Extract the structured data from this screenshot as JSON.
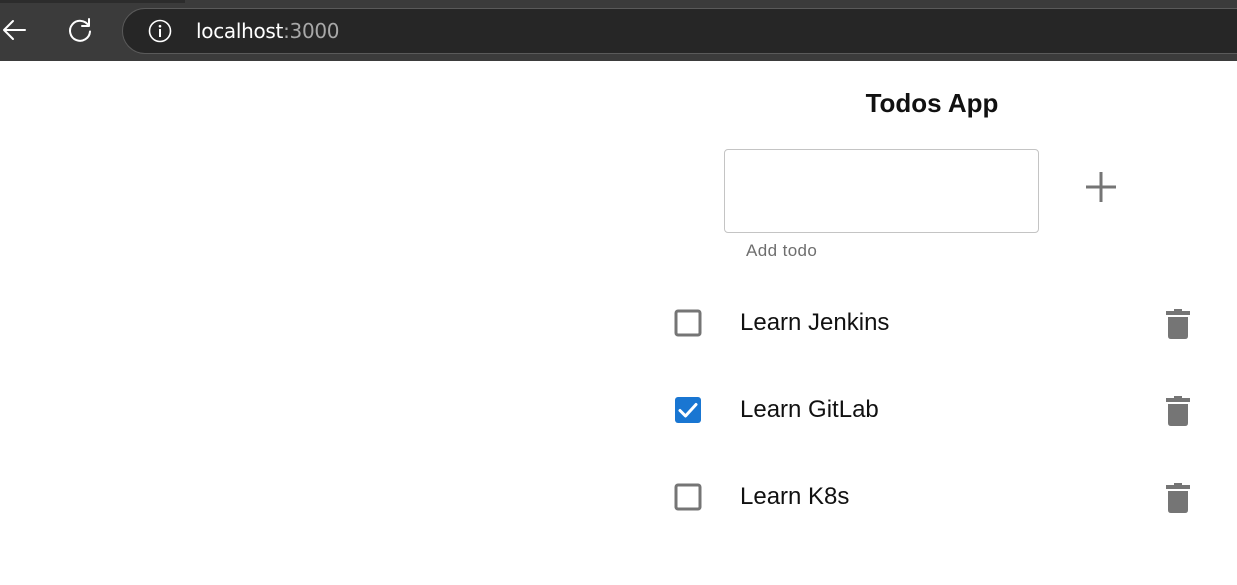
{
  "browser": {
    "url_host": "localhost",
    "url_port": ":3000",
    "back_icon": "back-arrow-icon",
    "reload_icon": "reload-icon",
    "info_icon": "info-icon"
  },
  "app": {
    "title": "Todos App",
    "input": {
      "value": "",
      "helper_text": "Add todo"
    },
    "add_icon": "plus-icon",
    "accent_color": "#1976d2",
    "icon_color": "#757575"
  },
  "todos": [
    {
      "text": "Learn Jenkins",
      "completed": false
    },
    {
      "text": "Learn GitLab",
      "completed": true
    },
    {
      "text": "Learn K8s",
      "completed": false
    }
  ]
}
